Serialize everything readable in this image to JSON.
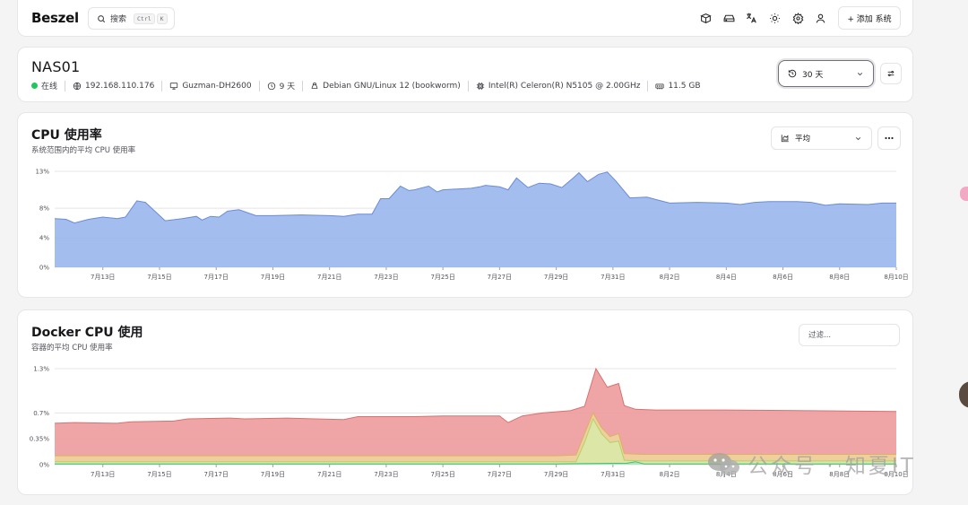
{
  "header": {
    "logo": "Beszel",
    "search_label": "搜索",
    "search_shortcut_1": "Ctrl",
    "search_shortcut_2": "K",
    "add_system_label": "+ 添加 系统",
    "icons": [
      "box-icon",
      "hard-drive-icon",
      "language-icon",
      "sun-icon",
      "gear-icon",
      "user-icon"
    ]
  },
  "system": {
    "name": "NAS01",
    "status": "在线",
    "status_color": "#22c55e",
    "ip": "192.168.110.176",
    "hostname": "Guzman-DH2600",
    "uptime": "9 天",
    "os": "Debian GNU/Linux 12 (bookworm)",
    "cpu": "Intel(R) Celeron(R) N5105 @ 2.00GHz",
    "memory": "11.5 GB",
    "time_range": "30 天"
  },
  "cpu_card": {
    "title": "CPU 使用率",
    "subtitle": "系统范围内的平均 CPU 使用率",
    "select_label": "平均"
  },
  "docker_card": {
    "title": "Docker CPU 使用",
    "subtitle": "容器的平均 CPU 使用率",
    "filter_placeholder": "过滤..."
  },
  "watermark": "公众号 · 知夏IT",
  "chart_data": [
    {
      "type": "area",
      "title": "CPU 使用率",
      "x_ticks": [
        "7月13日",
        "7月15日",
        "7月17日",
        "7月19日",
        "7月21日",
        "7月23日",
        "7月25日",
        "7月27日",
        "7月29日",
        "7月31日",
        "8月2日",
        "8月4日",
        "8月6日",
        "8月8日",
        "8月10日"
      ],
      "y_ticks": [
        "0%",
        "4%",
        "8%",
        "13%"
      ],
      "ylim": [
        0,
        13
      ],
      "x_range_days": [
        11.3,
        41.0
      ],
      "color": "#94b2ec",
      "stroke": "#6a8bd8",
      "points": [
        [
          11.3,
          6.6
        ],
        [
          11.7,
          6.5
        ],
        [
          12.0,
          6.0
        ],
        [
          12.5,
          6.5
        ],
        [
          13.0,
          6.8
        ],
        [
          13.5,
          6.6
        ],
        [
          13.8,
          6.8
        ],
        [
          14.2,
          9.0
        ],
        [
          14.5,
          8.8
        ],
        [
          15.2,
          6.3
        ],
        [
          15.8,
          6.6
        ],
        [
          16.3,
          6.9
        ],
        [
          16.5,
          6.4
        ],
        [
          16.8,
          6.9
        ],
        [
          17.1,
          6.8
        ],
        [
          17.4,
          7.6
        ],
        [
          17.8,
          7.8
        ],
        [
          18.4,
          7.0
        ],
        [
          19.0,
          7.0
        ],
        [
          20.0,
          7.1
        ],
        [
          21.0,
          7.0
        ],
        [
          21.5,
          6.9
        ],
        [
          22.0,
          7.2
        ],
        [
          22.5,
          7.2
        ],
        [
          22.8,
          9.3
        ],
        [
          23.1,
          9.3
        ],
        [
          23.5,
          11.0
        ],
        [
          23.8,
          10.4
        ],
        [
          24.0,
          10.5
        ],
        [
          24.5,
          11.0
        ],
        [
          24.8,
          10.2
        ],
        [
          25.0,
          10.5
        ],
        [
          26.0,
          10.7
        ],
        [
          26.3,
          10.9
        ],
        [
          26.5,
          11.1
        ],
        [
          27.0,
          10.9
        ],
        [
          27.3,
          10.5
        ],
        [
          27.6,
          12.1
        ],
        [
          28.0,
          10.8
        ],
        [
          28.4,
          11.4
        ],
        [
          28.8,
          11.3
        ],
        [
          29.2,
          10.8
        ],
        [
          29.6,
          12.1
        ],
        [
          29.8,
          12.8
        ],
        [
          30.1,
          11.6
        ],
        [
          30.5,
          12.6
        ],
        [
          30.8,
          12.9
        ],
        [
          31.1,
          11.7
        ],
        [
          31.6,
          9.4
        ],
        [
          32.2,
          9.5
        ],
        [
          32.6,
          9.1
        ],
        [
          33.0,
          8.7
        ],
        [
          34.0,
          8.8
        ],
        [
          35.0,
          8.7
        ],
        [
          35.5,
          8.5
        ],
        [
          36.0,
          8.8
        ],
        [
          36.5,
          8.9
        ],
        [
          37.5,
          8.9
        ],
        [
          38.0,
          8.8
        ],
        [
          38.5,
          8.4
        ],
        [
          39.0,
          8.6
        ],
        [
          40.0,
          8.5
        ],
        [
          40.5,
          8.7
        ],
        [
          41.0,
          8.7
        ]
      ]
    },
    {
      "type": "area",
      "title": "Docker CPU 使用",
      "x_ticks": [
        "7月13日",
        "7月15日",
        "7月17日",
        "7月19日",
        "7月21日",
        "7月23日",
        "7月25日",
        "7月27日",
        "7月29日",
        "7月31日",
        "8月2日",
        "8月4日",
        "8月6日",
        "8月8日",
        "8月10日"
      ],
      "y_ticks": [
        "0%",
        "0.35%",
        "0.7%",
        "1.3%"
      ],
      "ylim": [
        0,
        1.3
      ],
      "x_range_days": [
        11.3,
        41.0
      ],
      "series": [
        {
          "color": "#ed9b9b",
          "stroke": "#d97070",
          "points": [
            [
              11.3,
              0.56
            ],
            [
              12.0,
              0.57
            ],
            [
              13.5,
              0.56
            ],
            [
              14.0,
              0.58
            ],
            [
              15.5,
              0.59
            ],
            [
              16.0,
              0.62
            ],
            [
              17.5,
              0.63
            ],
            [
              18.0,
              0.62
            ],
            [
              19.5,
              0.63
            ],
            [
              20.5,
              0.62
            ],
            [
              21.5,
              0.61
            ],
            [
              22.0,
              0.65
            ],
            [
              24.0,
              0.65
            ],
            [
              25.0,
              0.66
            ],
            [
              27.0,
              0.66
            ],
            [
              27.3,
              0.57
            ],
            [
              27.8,
              0.66
            ],
            [
              28.5,
              0.7
            ],
            [
              29.5,
              0.73
            ],
            [
              30.0,
              0.79
            ],
            [
              30.4,
              1.3
            ],
            [
              30.8,
              1.05
            ],
            [
              31.2,
              1.1
            ],
            [
              31.4,
              0.8
            ],
            [
              31.8,
              0.75
            ],
            [
              32.5,
              0.74
            ],
            [
              35.0,
              0.74
            ],
            [
              38.0,
              0.73
            ],
            [
              41.0,
              0.72
            ]
          ]
        },
        {
          "color": "#edd49c",
          "stroke": "#d9b260",
          "points": [
            [
              11.3,
              0.12
            ],
            [
              15.0,
              0.12
            ],
            [
              20.0,
              0.12
            ],
            [
              25.0,
              0.12
            ],
            [
              29.0,
              0.12
            ],
            [
              29.7,
              0.13
            ],
            [
              30.0,
              0.42
            ],
            [
              30.3,
              0.7
            ],
            [
              30.6,
              0.5
            ],
            [
              30.9,
              0.38
            ],
            [
              31.2,
              0.42
            ],
            [
              31.4,
              0.15
            ],
            [
              32.0,
              0.14
            ],
            [
              35.0,
              0.14
            ],
            [
              41.0,
              0.14
            ]
          ]
        },
        {
          "color": "#d8e8a8",
          "stroke": "#b6d06a",
          "points": [
            [
              11.3,
              0.04
            ],
            [
              29.7,
              0.04
            ],
            [
              30.0,
              0.3
            ],
            [
              30.3,
              0.62
            ],
            [
              30.6,
              0.42
            ],
            [
              30.9,
              0.3
            ],
            [
              31.2,
              0.32
            ],
            [
              31.4,
              0.06
            ],
            [
              32.0,
              0.05
            ],
            [
              41.0,
              0.05
            ]
          ]
        },
        {
          "color": "#a7e3c2",
          "stroke": "#3fbf7a",
          "points": [
            [
              11.3,
              0.01
            ],
            [
              20.0,
              0.01
            ],
            [
              29.0,
              0.01
            ],
            [
              31.5,
              0.02
            ],
            [
              31.8,
              0.04
            ],
            [
              32.1,
              0.01
            ],
            [
              41.0,
              0.01
            ]
          ]
        }
      ]
    }
  ]
}
